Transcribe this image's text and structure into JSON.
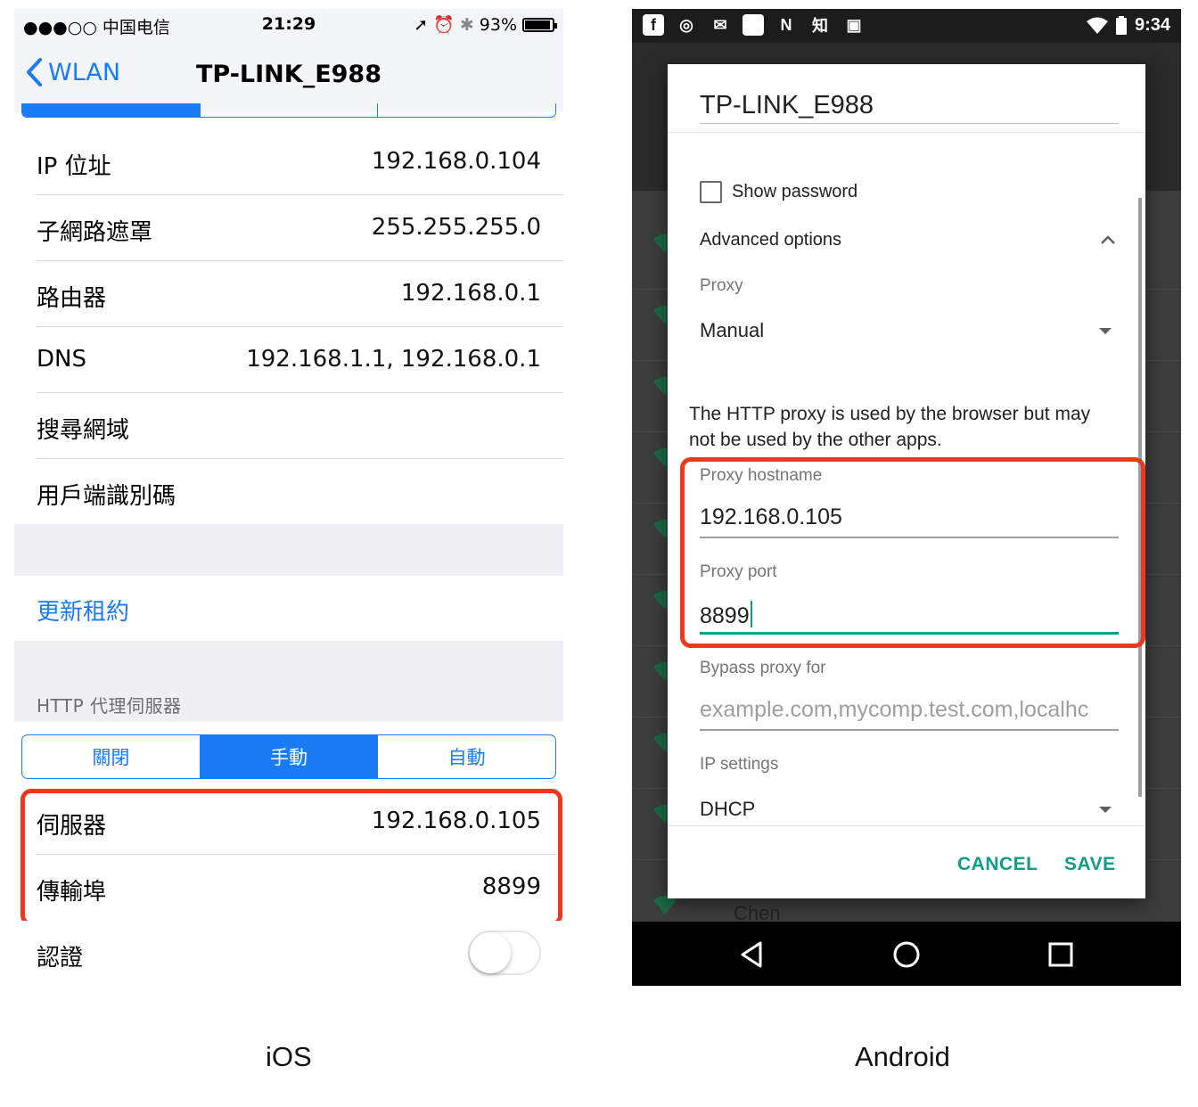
{
  "ios": {
    "status": {
      "carrier": "●●●○○ 中国电信",
      "time": "21:29",
      "battery": "93%",
      "battery_level": 0.93
    },
    "nav": {
      "back": "WLAN",
      "title": "TP-LINK_E988"
    },
    "rows": [
      {
        "label": "IP 位址",
        "value": "192.168.0.104"
      },
      {
        "label": "子網路遮罩",
        "value": "255.255.255.0"
      },
      {
        "label": "路由器",
        "value": "192.168.0.1"
      },
      {
        "label": "DNS",
        "value": "192.168.1.1, 192.168.0.1"
      },
      {
        "label": "搜尋網域",
        "value": ""
      },
      {
        "label": "用戶端識別碼",
        "value": ""
      }
    ],
    "renew": "更新租約",
    "proxy_section": "HTTP 代理伺服器",
    "proxy_modes": [
      "關閉",
      "手動",
      "自動"
    ],
    "proxy_mode_selected": "手動",
    "server": {
      "label": "伺服器",
      "value": "192.168.0.105"
    },
    "port": {
      "label": "傳輸埠",
      "value": "8899"
    },
    "auth": {
      "label": "認證",
      "enabled": false
    },
    "caption": "iOS"
  },
  "android": {
    "status": {
      "time": "9:34",
      "zhihu": "知"
    },
    "list_item": "Chen",
    "dialog": {
      "title": "TP-LINK_E988",
      "show_password": "Show password",
      "advanced": "Advanced options",
      "proxy_label": "Proxy",
      "proxy_value": "Manual",
      "note": "The HTTP proxy is used by the browser but may not be used by the other apps.",
      "hostname_label": "Proxy hostname",
      "hostname_value": "192.168.0.105",
      "port_label": "Proxy port",
      "port_value": "8899",
      "bypass_label": "Bypass proxy for",
      "bypass_placeholder": "example.com,mycomp.test.com,localhc",
      "ip_label": "IP settings",
      "ip_value": "DHCP",
      "cancel": "CANCEL",
      "save": "SAVE"
    },
    "caption": "Android"
  },
  "colors": {
    "ios_blue": "#1a7cf5",
    "android_teal": "#0f9d88",
    "highlight_red": "#f2371c"
  }
}
